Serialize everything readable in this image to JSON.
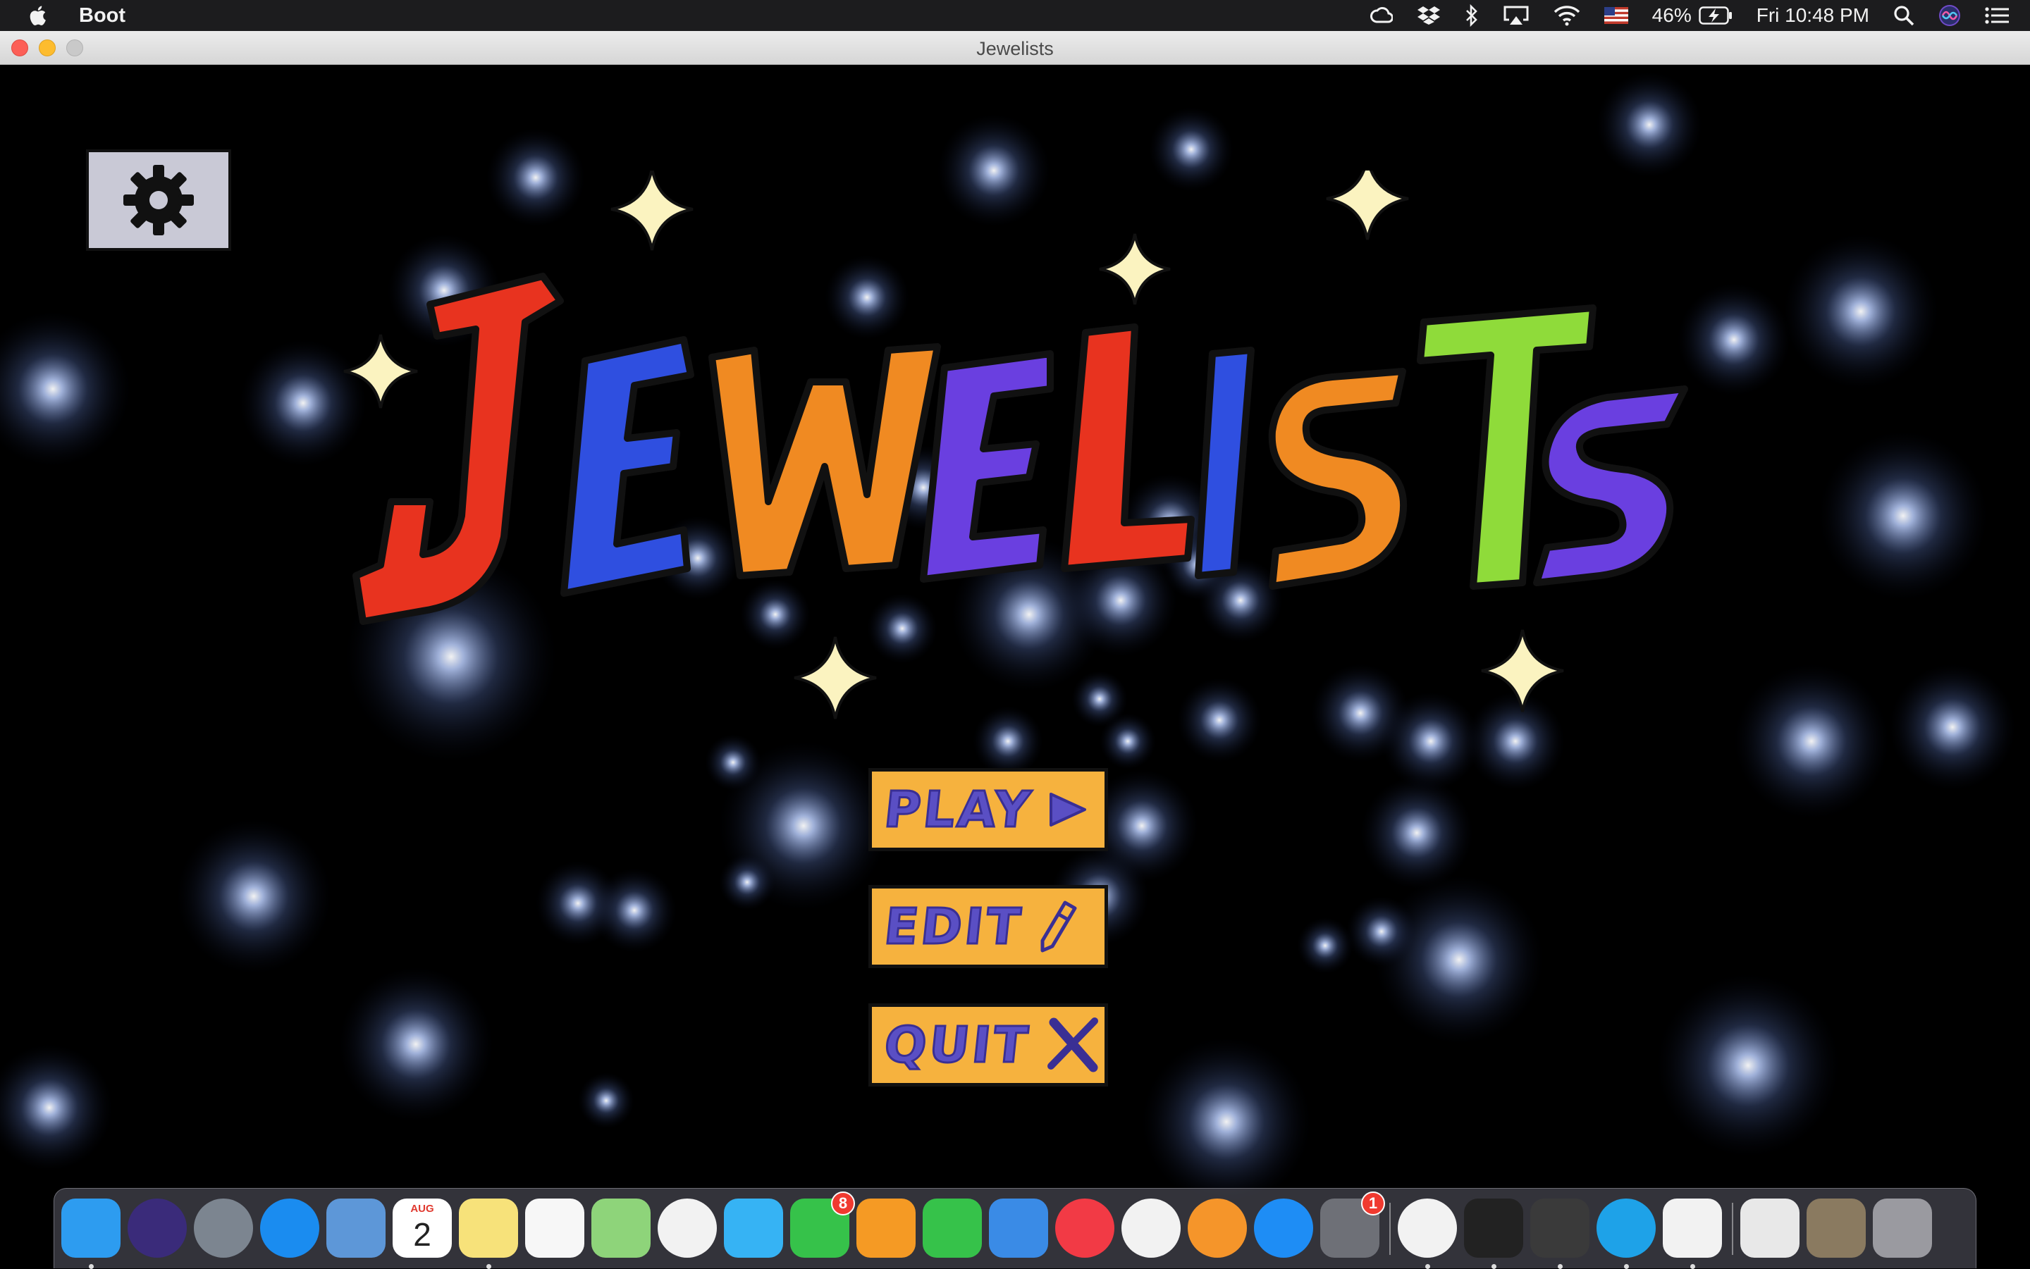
{
  "menubar": {
    "app_name": "Boot",
    "battery_percent": "46%",
    "clock": "Fri 10:48 PM",
    "icons": [
      "apple-icon",
      "creative-cloud-icon",
      "dropbox-icon",
      "bluetooth-icon",
      "airplay-icon",
      "wifi-icon",
      "us-flag-icon",
      "battery-charging-icon",
      "spotlight-search-icon",
      "siri-icon",
      "notification-center-icon"
    ]
  },
  "window": {
    "title": "Jewelists"
  },
  "game": {
    "logo_text": "Jewelists",
    "letters": [
      "J",
      "E",
      "W",
      "E",
      "L",
      "I",
      "S",
      "T",
      "S"
    ],
    "letter_colors": [
      "#e8331f",
      "#2f4fe0",
      "#f08a22",
      "#6a3fe0",
      "#e8331f",
      "#2f4fe0",
      "#f08a22",
      "#8fdb3a",
      "#6a3fe0"
    ],
    "sparkle_color": "#fbf3c0",
    "button_color": "#f6b23e",
    "button_text_color": "#5a4fc4",
    "buttons": {
      "play": "PLAY",
      "edit": "EDIT",
      "quit": "QUIT"
    },
    "settings_icon": "gear-icon"
  },
  "dock": {
    "items": [
      {
        "name": "finder-icon",
        "color": "#2d9cf0"
      },
      {
        "name": "siri-icon",
        "color": "#3a2b7a"
      },
      {
        "name": "launchpad-icon",
        "color": "#7c8590"
      },
      {
        "name": "safari-icon",
        "color": "#1a8cf0"
      },
      {
        "name": "mail-icon",
        "color": "#5d97d8"
      },
      {
        "name": "calendar-icon",
        "color": "#ffffff"
      },
      {
        "name": "notes-icon",
        "color": "#f7e27a"
      },
      {
        "name": "reminders-icon",
        "color": "#f7f7f7"
      },
      {
        "name": "maps-icon",
        "color": "#8ed47a"
      },
      {
        "name": "photos-icon",
        "color": "#f2f2f2"
      },
      {
        "name": "messages-icon",
        "color": "#36b3f4"
      },
      {
        "name": "facetime-icon",
        "color": "#36c24a"
      },
      {
        "name": "pages-icon",
        "color": "#f59a24"
      },
      {
        "name": "numbers-icon",
        "color": "#36c24a"
      },
      {
        "name": "keynote-icon",
        "color": "#3a8be6"
      },
      {
        "name": "news-icon",
        "color": "#f23a45"
      },
      {
        "name": "itunes-icon",
        "color": "#f2f2f2"
      },
      {
        "name": "books-icon",
        "color": "#f5952a"
      },
      {
        "name": "app-store-icon",
        "color": "#1e8df5"
      },
      {
        "name": "system-preferences-icon",
        "color": "#6e7077"
      },
      {
        "name": "chrome-icon",
        "color": "#f2f2f2"
      },
      {
        "name": "terminal-icon",
        "color": "#222222"
      },
      {
        "name": "sublime-text-icon",
        "color": "#3a3a3a"
      },
      {
        "name": "skype-icon",
        "color": "#1ea2e8"
      },
      {
        "name": "java-icon",
        "color": "#f2f2f2"
      },
      {
        "name": "music-folder-icon",
        "color": "#e8e8e8"
      },
      {
        "name": "downloads-stack-icon",
        "color": "#8a7a60"
      },
      {
        "name": "trash-icon",
        "color": "#9a9aa0"
      }
    ],
    "calendar": {
      "month": "AUG",
      "day": "2"
    },
    "facetime_badge": "8",
    "system_preferences_badge": "1"
  }
}
